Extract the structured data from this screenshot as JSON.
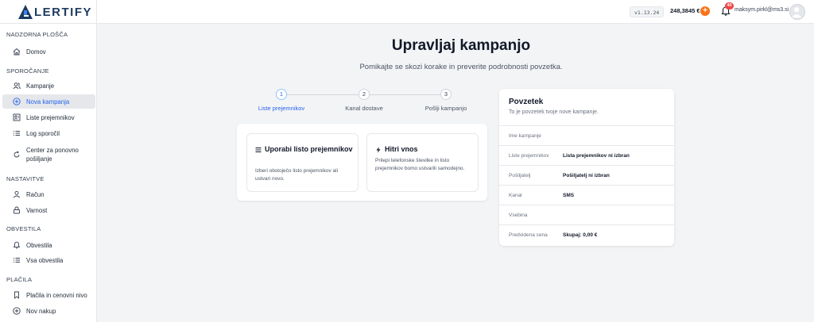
{
  "app": {
    "logo_text": "LERTIFY",
    "version": "v1.13.24",
    "balance": "248,3845 €",
    "add_symbol": "+",
    "notifications_count": "40",
    "user_email": "maksym.pirkl@ms3.si"
  },
  "sidebar": {
    "sections": [
      {
        "title": "NADZORNA PLOŠČA",
        "items": [
          {
            "label": "Domov",
            "icon": "home-icon"
          }
        ]
      },
      {
        "title": "SPOROČANJE",
        "items": [
          {
            "label": "Kampanje",
            "icon": "users-icon"
          },
          {
            "label": "Nova kampanja",
            "icon": "plus-circle-icon",
            "active": true
          },
          {
            "label": "Liste prejemnikov",
            "icon": "contact-list-icon"
          },
          {
            "label": "Log sporočil",
            "icon": "list-icon"
          },
          {
            "label": "Center za ponovno pošiljanje",
            "icon": "refresh-icon"
          }
        ]
      },
      {
        "title": "NASTAVITVE",
        "items": [
          {
            "label": "Račun",
            "icon": "user-icon"
          },
          {
            "label": "Varnost",
            "icon": "lock-icon"
          }
        ]
      },
      {
        "title": "OBVESTILA",
        "items": [
          {
            "label": "Obvestila",
            "icon": "bell-icon"
          },
          {
            "label": "Vsa obvestila",
            "icon": "list-icon"
          }
        ]
      },
      {
        "title": "PLAČILA",
        "items": [
          {
            "label": "Plačila in cenovni nivo",
            "icon": "bookmark-icon"
          },
          {
            "label": "Nov nakup",
            "icon": "plus-circle-icon"
          }
        ]
      }
    ]
  },
  "main": {
    "title": "Upravljaj kampanjo",
    "subtitle": "Pomikajte se skozi korake in preverite podrobnosti povzetka.",
    "steps": [
      {
        "number": "1",
        "label": "Liste prejemnikov",
        "active": true
      },
      {
        "number": "2",
        "label": "Kanal dostave",
        "active": false
      },
      {
        "number": "3",
        "label": "Pošlji kampanjo",
        "active": false
      }
    ],
    "methods": [
      {
        "title": "Uporabi listo prejemnikov",
        "description": "Izberi obstoječo listo prejemnikov ali ustvari novo.",
        "icon": "list-icon"
      },
      {
        "title": "Hitri vnos",
        "description": "Prilepi telefonske številke in listo prejemnikov bomo ustvarili samodejno.",
        "icon": "lightning-icon"
      }
    ]
  },
  "summary": {
    "title": "Povzetek",
    "subtitle": "To je povzetek tvoje nove kampanje.",
    "rows": [
      {
        "label": "Ime kampanje",
        "value": ""
      },
      {
        "label": "Liste prejemnikov",
        "value": "Lista prejemnikov ni izbran"
      },
      {
        "label": "Pošiljatelj",
        "value": "Pošiljatelj ni izbran"
      },
      {
        "label": "Kanal",
        "value": "SMS"
      },
      {
        "label": "Vsebina",
        "value": ""
      },
      {
        "label": "Predvidena cena",
        "value": "Skupaj: 0,00 €"
      }
    ]
  },
  "colors": {
    "accent": "#2563eb",
    "brand": "#1e3a5f",
    "warning": "#f97316",
    "badge": "#ef4444"
  }
}
